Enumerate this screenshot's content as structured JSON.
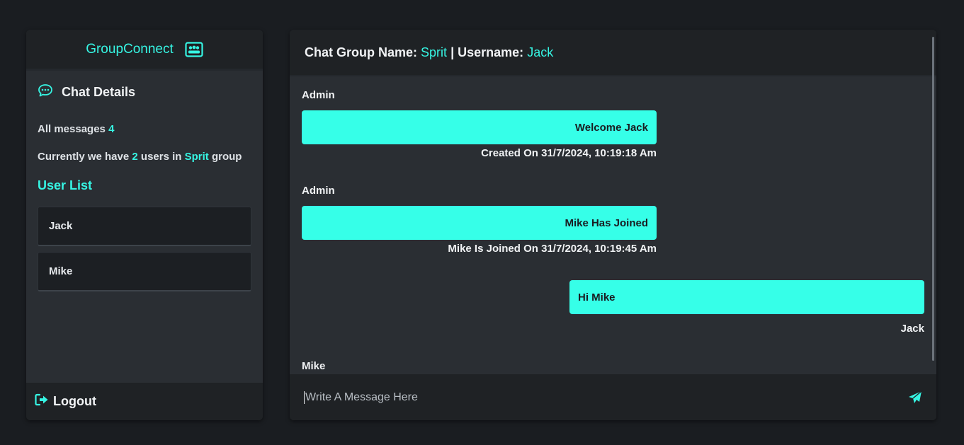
{
  "sidebar": {
    "brand": "GroupConnect",
    "brand_icon": "id-card-icon",
    "details_title": "Chat Details",
    "details_icon": "chat-dots-icon",
    "all_messages_label": "All messages",
    "all_messages_count": "4",
    "users_prefix": "Currently we have",
    "users_count": "2",
    "users_mid": "users in",
    "group_name": "Sprit",
    "users_suffix": "group",
    "user_list_title": "User List",
    "users": [
      "Jack",
      "Mike"
    ],
    "logout_label": "Logout",
    "logout_icon": "logout-icon"
  },
  "chat": {
    "group_label": "Chat Group Name:",
    "group_name": "Sprit",
    "separator": "|",
    "username_label": "Username:",
    "username": "Jack",
    "messages": [
      {
        "sender": "Admin",
        "text": "Welcome Jack",
        "meta": "Created On 31/7/2024, 10:19:18 Am"
      },
      {
        "sender": "Admin",
        "text": "Mike Has Joined",
        "meta": "Mike Is Joined On 31/7/2024, 10:19:45 Am"
      },
      {
        "sender": "Jack",
        "text": "Hi Mike"
      },
      {
        "sender": "Mike"
      }
    ],
    "input_placeholder": "Write A Message Here",
    "send_icon": "paper-plane-icon"
  },
  "colors": {
    "accent": "#36f5e3",
    "bubble": "#36ffe8",
    "panel": "#2a2e33",
    "header": "#1f2225",
    "background": "#1a1d21"
  }
}
